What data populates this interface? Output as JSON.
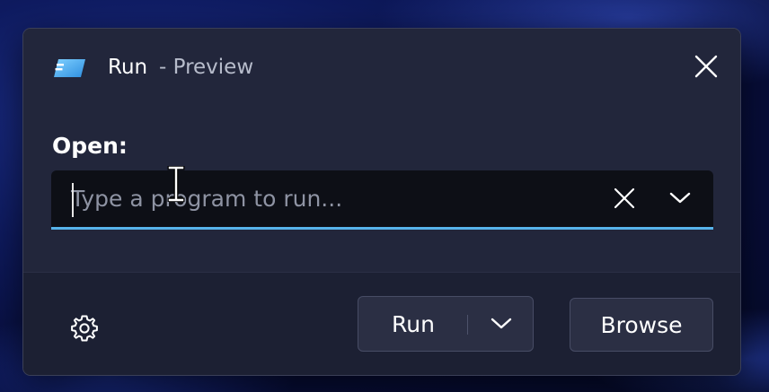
{
  "dialog": {
    "title": "Run",
    "subtitle": "- Preview",
    "app_icon": "run-app-icon",
    "close_icon": "close-icon"
  },
  "form": {
    "open_label": "Open:",
    "input_value": "",
    "input_placeholder": "Type a program to run...",
    "clear_icon": "clear-icon",
    "history_icon": "chevron-down-icon"
  },
  "footer": {
    "settings_icon": "gear-icon",
    "run_label": "Run",
    "run_dropdown_icon": "chevron-down-icon",
    "browse_label": "Browse"
  },
  "colors": {
    "accent": "#57b3ea",
    "dialog_bg": "#22263b",
    "input_bg": "#0d0f16",
    "button_bg": "#2b2f44"
  }
}
